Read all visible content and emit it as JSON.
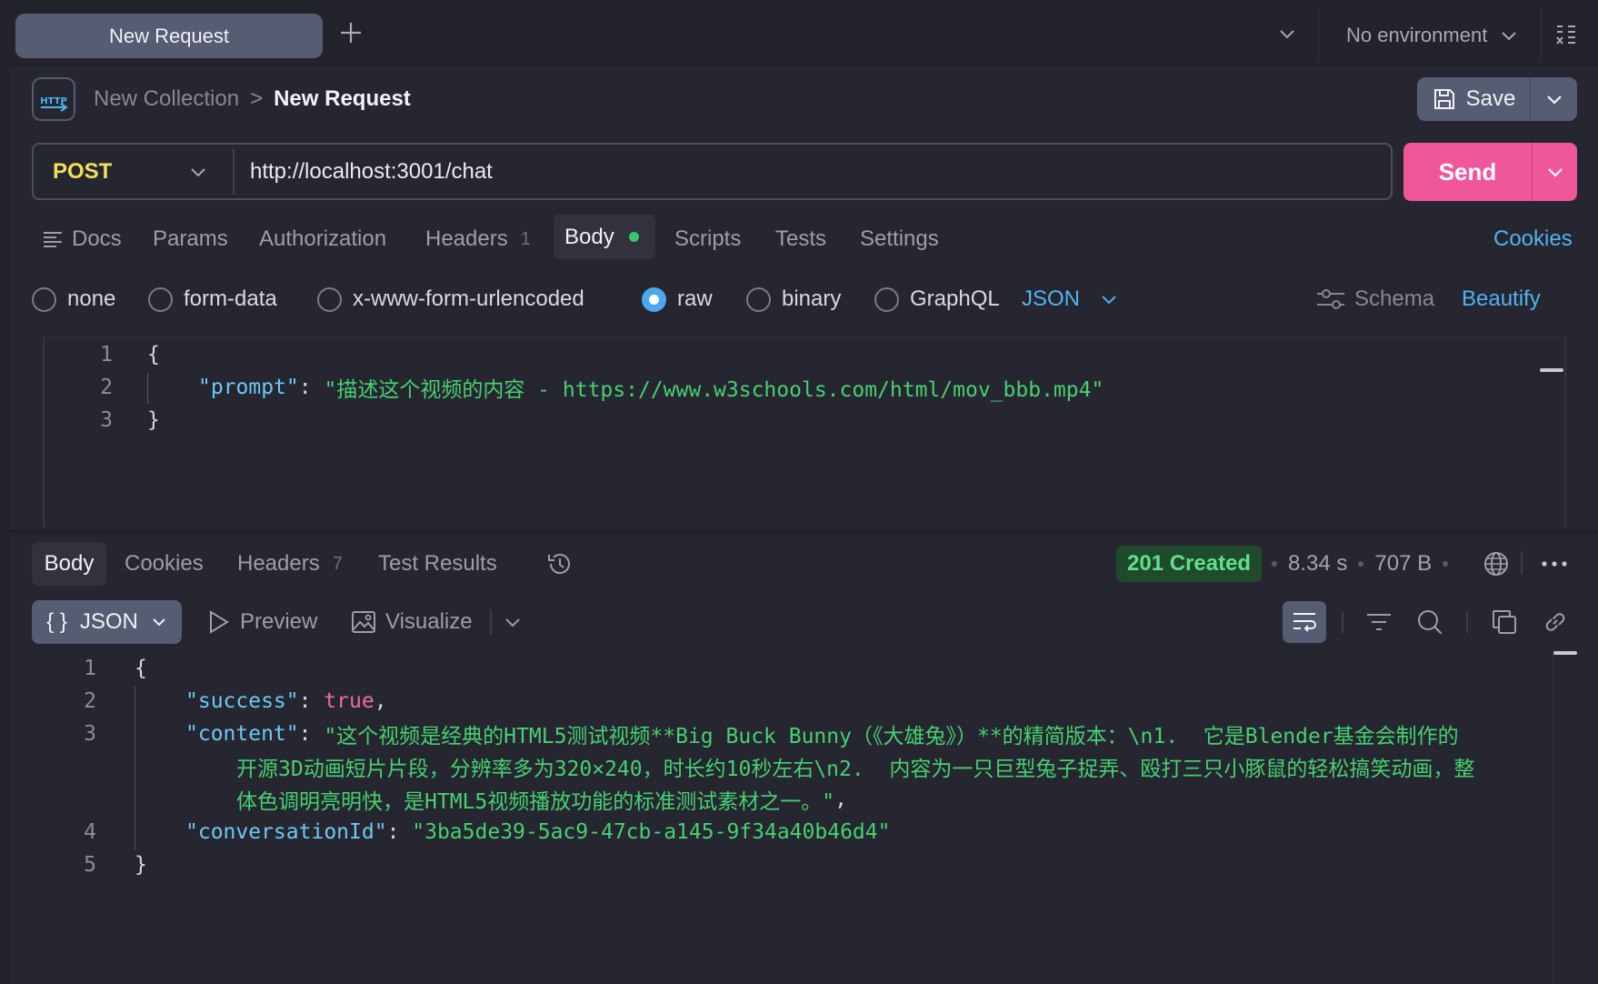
{
  "tabs": {
    "active_tab_label": "New Request",
    "environment_label": "No environment"
  },
  "breadcrumb": {
    "icon_text": "HTTP",
    "collection": "New Collection",
    "separator": ">",
    "request": "New Request"
  },
  "toolbar": {
    "save_label": "Save",
    "send_label": "Send"
  },
  "request": {
    "method": "POST",
    "url": "http://localhost:3001/chat",
    "tabs": [
      {
        "label": "Docs"
      },
      {
        "label": "Params"
      },
      {
        "label": "Authorization"
      },
      {
        "label": "Headers",
        "count": "1"
      },
      {
        "label": "Body"
      },
      {
        "label": "Scripts"
      },
      {
        "label": "Tests"
      },
      {
        "label": "Settings"
      }
    ],
    "cookies_label": "Cookies",
    "body_types": [
      "none",
      "form-data",
      "x-www-form-urlencoded",
      "raw",
      "binary",
      "GraphQL"
    ],
    "selected_body_type": "raw",
    "raw_format": "JSON",
    "schema_label": "Schema",
    "beautify_label": "Beautify",
    "code_lines": [
      {
        "num": "1",
        "open": "{"
      },
      {
        "num": "2",
        "key": "\"prompt\"",
        "colon": ": ",
        "value": "\"描述这个视频的内容 - https://www.w3schools.com/html/mov_bbb.mp4\""
      },
      {
        "num": "3",
        "close": "}"
      }
    ]
  },
  "response": {
    "tabs": [
      {
        "label": "Body"
      },
      {
        "label": "Cookies"
      },
      {
        "label": "Headers",
        "count": "7"
      },
      {
        "label": "Test Results"
      }
    ],
    "status": "201 Created",
    "time": "8.34 s",
    "size": "707 B",
    "format": "JSON",
    "format_glyph": "{ }",
    "preview_label": "Preview",
    "visualize_label": "Visualize",
    "line_numbers": [
      "1",
      "2",
      "3",
      "",
      "",
      "4",
      "5"
    ],
    "code": {
      "open": "{",
      "success_key": "\"success\"",
      "success_value": "true",
      "content_key": "\"content\"",
      "content_line1": "\"这个视频是经典的HTML5测试视频**Big Buck Bunny（《大雄兔》）**的精简版本：\\n1.  它是Blender基金会制作的",
      "content_line2": "开源3D动画短片片段，分辨率多为320×240，时长约10秒左右\\n2.  内容为一只巨型兔子捉弄、殴打三只小豚鼠的轻松搞笑动画，整",
      "content_line3": "体色调明亮明快，是HTML5视频播放功能的标准测试素材之一。\"",
      "conv_key": "\"conversationId\"",
      "conv_value": "\"3ba5de39-5ac9-47cb-a145-9f34a40b46d4\"",
      "close": "}"
    }
  },
  "colors": {
    "accent_blue": "#4fb3f0",
    "send_pink": "#f0569a",
    "method_yellow": "#f3de5a",
    "status_green": "#5fe08a",
    "string_green": "#45d16f",
    "key_blue": "#6cc8f2",
    "bool_pink": "#f06aa6"
  }
}
